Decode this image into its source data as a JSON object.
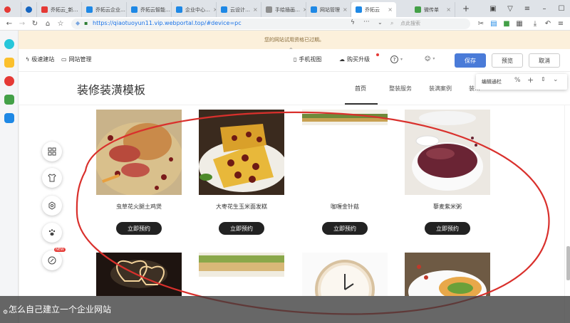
{
  "tabs": [
    {
      "label": "乔拓云_新…",
      "color": "#e53935"
    },
    {
      "label": "乔拓云企业…",
      "color": "#1e88e5"
    },
    {
      "label": "乔拓云智能…",
      "color": "#1e88e5"
    },
    {
      "label": "企业中心…",
      "color": "#1e88e5"
    },
    {
      "label": "云设计…",
      "color": "#1e88e5"
    },
    {
      "label": "手绘插画…",
      "color": "#8e8e8e"
    },
    {
      "label": "网站管理",
      "color": "#1e88e5"
    },
    {
      "label": "乔拓云",
      "color": "#1e88e5"
    },
    {
      "label": "微传单",
      "color": "#43a047"
    }
  ],
  "address": {
    "url": "https://qiaotuoyun11.vip.webportal.top/#device=pc",
    "search_placeholder": "点此搜索"
  },
  "notice": "您的网站试用资格已过期。",
  "editor": {
    "quick_build": "极速建站",
    "site_manage": "网站管理",
    "mobile_view": "手机视图",
    "buy_upgrade": "购买升级",
    "help": "?",
    "save": "保存",
    "preview": "预览",
    "cancel": "取消",
    "edit_column": "编辑通栏"
  },
  "site": {
    "title": "装修装潢模板",
    "nav": [
      "首页",
      "整装服务",
      "装满案例",
      "装…"
    ]
  },
  "products": [
    {
      "name": "虫草花火腿土鸡煲",
      "button": "立即预约"
    },
    {
      "name": "大枣花生玉米面发糕",
      "button": "立即预约"
    },
    {
      "name": "咖喱金针菇",
      "button": "立即预约"
    },
    {
      "name": "藜麦紫米粥",
      "button": "立即预约"
    }
  ],
  "tools": {
    "new_badge": "NEW"
  },
  "caption": "怎么自己建立一个企业网站",
  "colors": {
    "accent": "#4a7bd8",
    "notice_bg": "#fcf0db",
    "annotation": "#d9302c"
  }
}
